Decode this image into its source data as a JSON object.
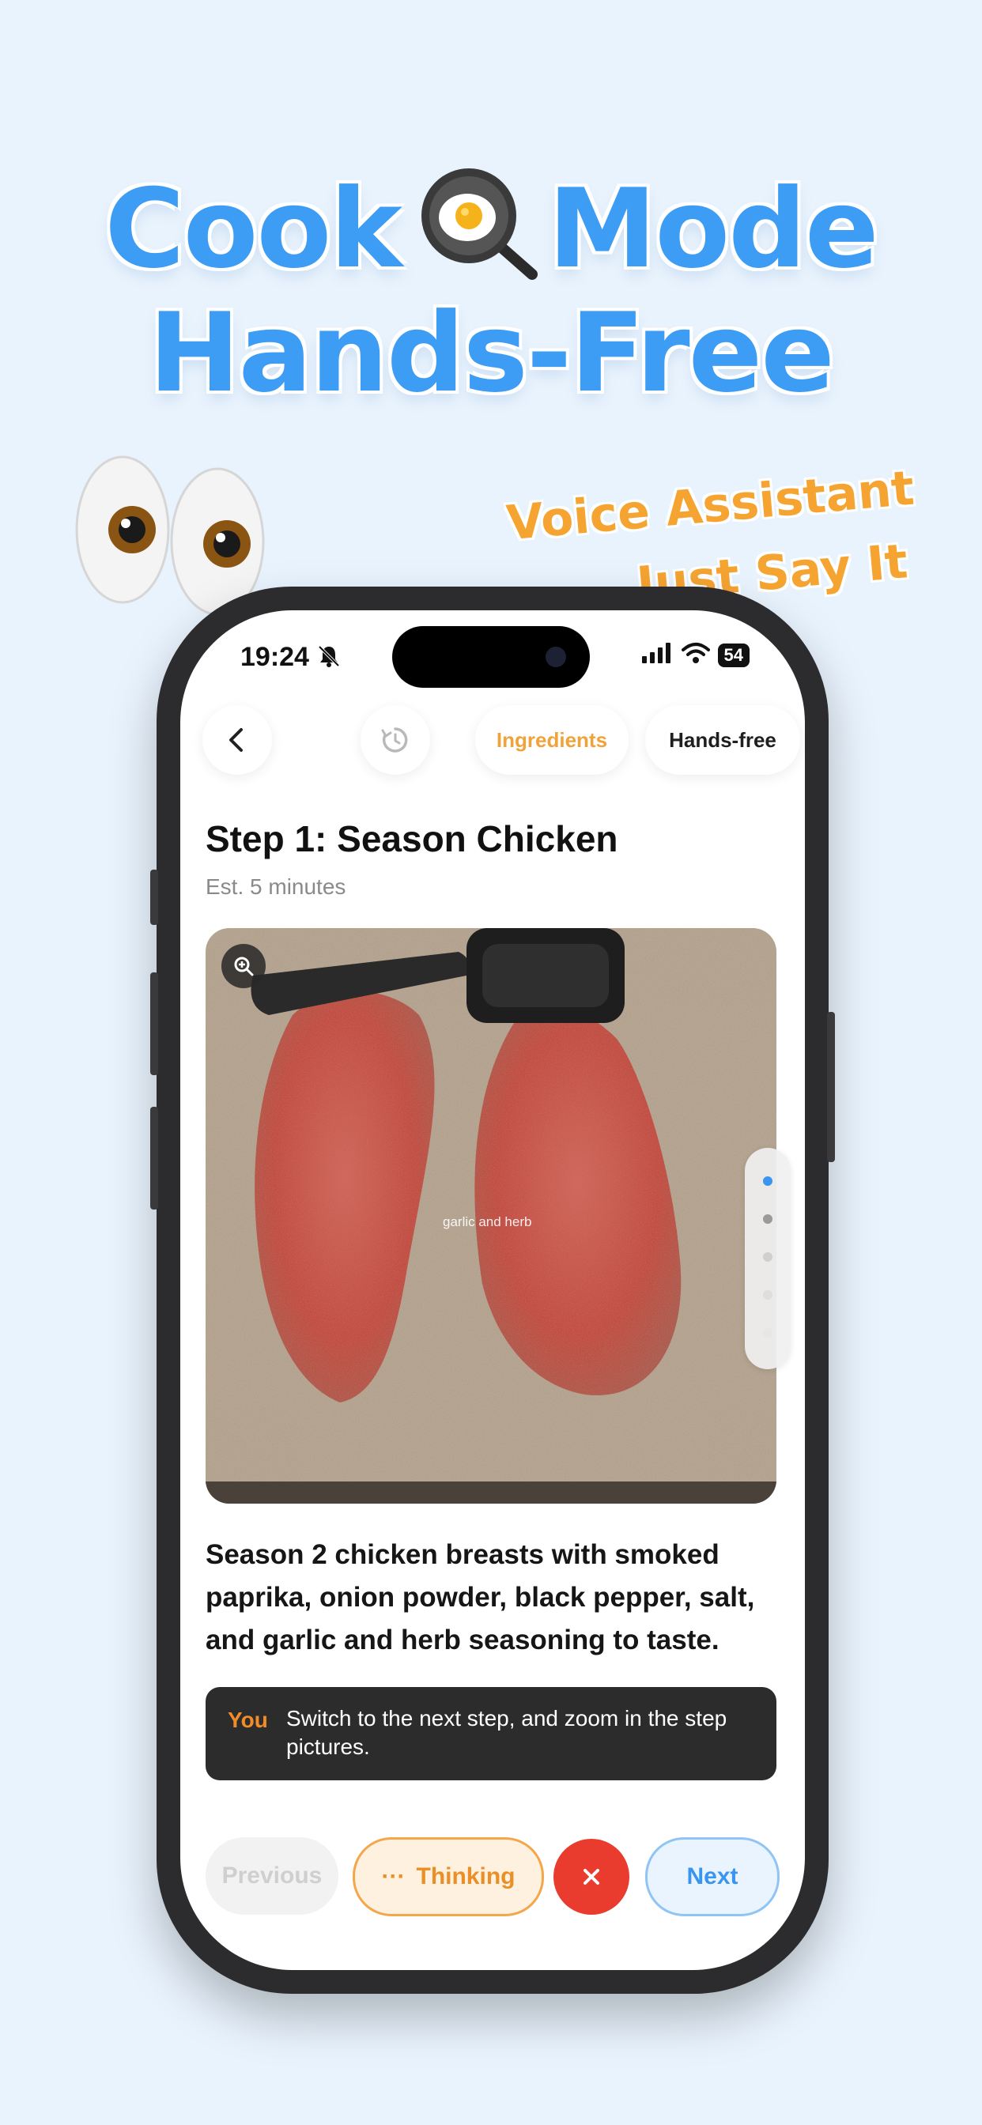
{
  "colors": {
    "headline": "#3d9cf3",
    "tagline": "#f5a431",
    "accent_orange": "#f0a33a",
    "next_blue": "#3a95ee",
    "cancel_red": "#ea3b2f",
    "background": "#e9f3fd"
  },
  "promo": {
    "headline_word1": "Cook",
    "headline_icon": "fried-egg-pan-icon",
    "headline_word2": "Mode",
    "headline_line2": "Hands-Free",
    "decor_icon": "eyes-icon",
    "tagline_line1": "Voice Assistant",
    "tagline_line2": "Just Say It"
  },
  "status_bar": {
    "time": "19:24",
    "battery": "54",
    "icons": [
      "bell-muted-icon",
      "signal-icon",
      "wifi-icon",
      "battery-icon"
    ]
  },
  "toolbar": {
    "back_icon": "chevron-left-icon",
    "timer_icon": "timer-icon",
    "ingredients_label": "Ingredients",
    "handsfree_label": "Hands-free"
  },
  "step": {
    "title": "Step 1: Season Chicken",
    "estimate": "Est. 5 minutes",
    "image_caption": "garlic and herb",
    "zoom_icon": "zoom-in-icon",
    "instruction": "Season 2 chicken breasts with smoked paprika, onion powder, black pepper, salt, and garlic and herb seasoning to taste.",
    "image_pages": 5,
    "current_image_page": 1
  },
  "voice": {
    "speaker_label": "You",
    "transcript": "Switch to the next step, and zoom in the step pictures."
  },
  "controls": {
    "previous_label": "Previous",
    "thinking_label": "Thinking",
    "thinking_icon": "ellipsis-icon",
    "cancel_icon": "close-icon",
    "next_label": "Next"
  }
}
